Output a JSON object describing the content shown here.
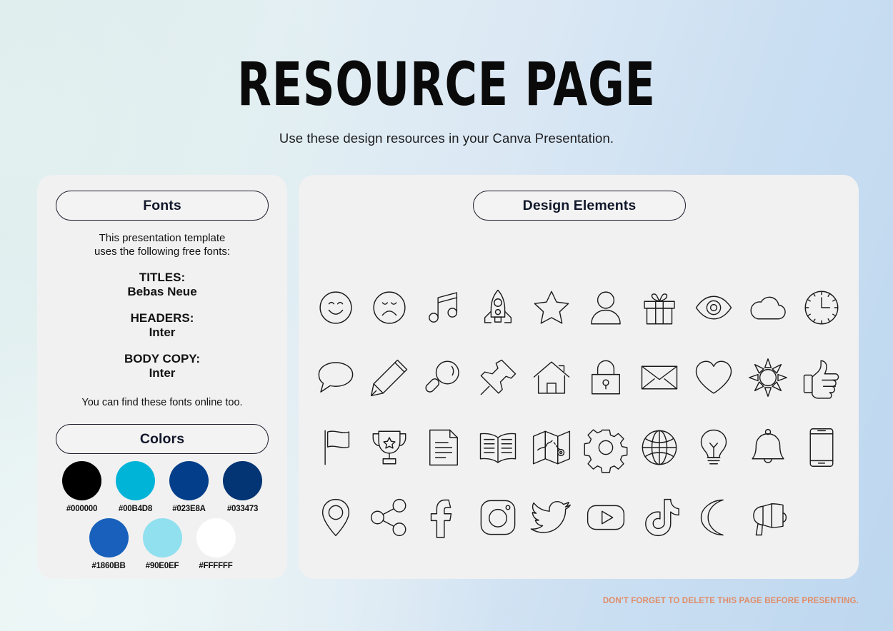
{
  "header": {
    "title": "RESOURCE PAGE",
    "subtitle": "Use these design resources in your Canva Presentation."
  },
  "fonts_panel": {
    "heading": "Fonts",
    "intro_line1": "This presentation template",
    "intro_line2": "uses the following free fonts:",
    "groups": [
      {
        "label": "TITLES:",
        "value": "Bebas Neue"
      },
      {
        "label": "HEADERS:",
        "value": "Inter"
      },
      {
        "label": "BODY COPY:",
        "value": "Inter"
      }
    ],
    "outro": "You can find these fonts online too."
  },
  "colors_panel": {
    "heading": "Colors",
    "row1": [
      {
        "hex": "#000000",
        "name": "swatch-black"
      },
      {
        "hex": "#00B4D8",
        "name": "swatch-cyan"
      },
      {
        "hex": "#023E8A",
        "name": "swatch-navy"
      },
      {
        "hex": "#033473",
        "name": "swatch-dark-navy"
      }
    ],
    "row2": [
      {
        "hex": "#1860BB",
        "name": "swatch-blue"
      },
      {
        "hex": "#90E0EF",
        "name": "swatch-light-blue"
      },
      {
        "hex": "#FFFFFF",
        "name": "swatch-white"
      }
    ]
  },
  "design_panel": {
    "heading": "Design Elements",
    "icons": [
      "smiley-face-icon",
      "sad-face-icon",
      "music-note-icon",
      "rocket-icon",
      "star-icon",
      "person-icon",
      "gift-icon",
      "eye-icon",
      "cloud-icon",
      "clock-icon",
      "speech-bubble-icon",
      "pencil-icon",
      "magnifying-glass-icon",
      "pushpin-icon",
      "house-icon",
      "lock-icon",
      "envelope-icon",
      "heart-icon",
      "sun-icon",
      "thumbs-up-icon",
      "flag-icon",
      "trophy-icon",
      "document-icon",
      "book-icon",
      "map-icon",
      "gear-icon",
      "globe-icon",
      "lightbulb-icon",
      "bell-icon",
      "smartphone-icon",
      "location-pin-icon",
      "share-icon",
      "facebook-icon",
      "instagram-icon",
      "twitter-icon",
      "youtube-icon",
      "tiktok-icon",
      "moon-icon",
      "megaphone-icon"
    ]
  },
  "footer": {
    "note": "DON'T FORGET TO DELETE THIS PAGE BEFORE PRESENTING.",
    "note_color": "#E08D6A"
  }
}
